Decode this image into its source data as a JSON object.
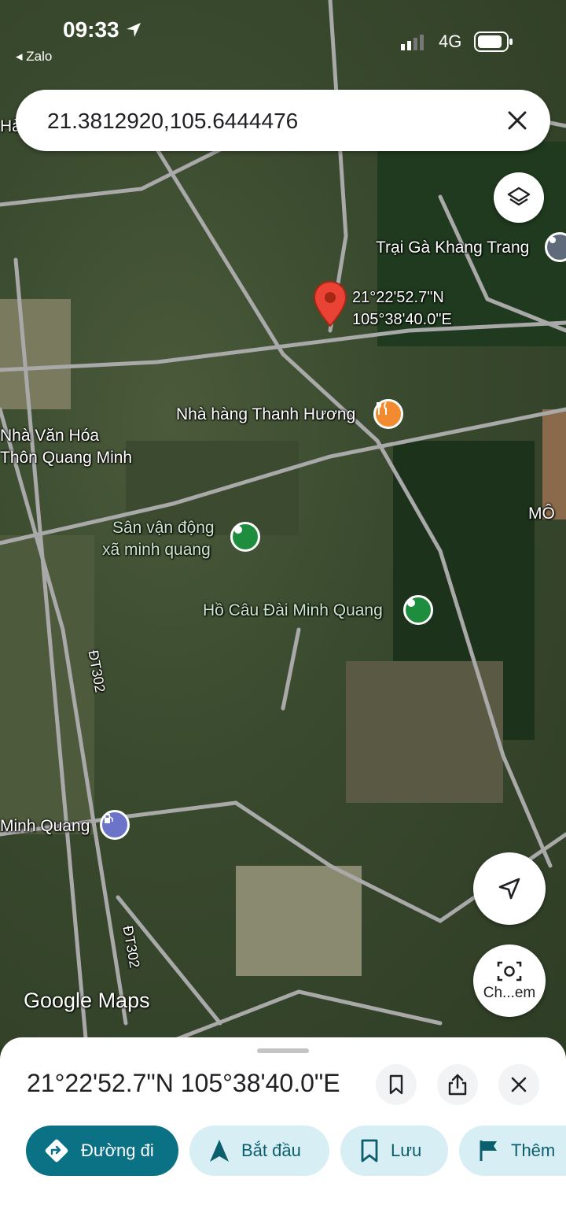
{
  "status": {
    "time": "09:33",
    "back_app": "◂ Zalo",
    "network": "4G"
  },
  "search": {
    "value": "21.3812920,105.6444476"
  },
  "map": {
    "pin_coord_lat": "21°22'52.7\"N",
    "pin_coord_lon": "105°38'40.0\"E",
    "labels": {
      "trai_ga": "Trại Gà Khang Trang",
      "nha_hang": "Nhà hàng Thanh Hương",
      "nha_van_hoa_1": "Nhà Văn Hóa",
      "nha_van_hoa_2": "Thôn Quang Minh",
      "mo": "MÔ",
      "san_van_dong_1": "Sân vận động",
      "san_van_dong_2": "xã minh quang",
      "ho_cau": "Hồ Câu Đài Minh Quang",
      "minh_quang": "Minh Quang",
      "road_1": "ĐT302",
      "road_2": "ĐT302",
      "ha": "Hà"
    },
    "logo": "Google Maps",
    "camera_label": "Ch...em"
  },
  "sheet": {
    "title": "21°22'52.7\"N 105°38'40.0\"E",
    "chips": {
      "directions": "Đường đi",
      "start": "Bắt đầu",
      "save": "Lưu",
      "more": "Thêm"
    }
  },
  "colors": {
    "accent": "#0b7285",
    "pin": "#ea4335",
    "chip_bg": "#d7eef5"
  }
}
